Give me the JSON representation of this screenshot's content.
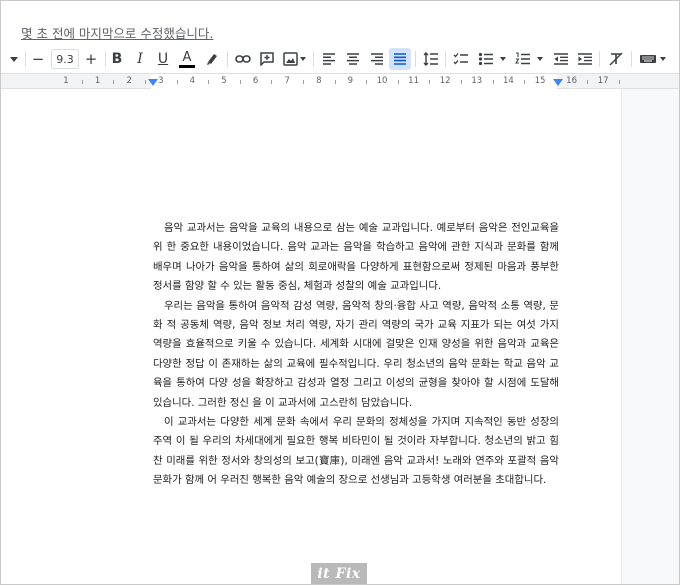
{
  "header": {
    "last_edit": "몇 초 전에 마지막으로 수정했습니다."
  },
  "toolbar": {
    "font_size": "9.3",
    "decrease_label": "−",
    "increase_label": "+",
    "bold_label": "B",
    "italic_label": "I",
    "underline_label": "U",
    "text_color_label": "A"
  },
  "ruler": {
    "ticks": [
      "1",
      "1",
      "2",
      "3",
      "4",
      "5",
      "6",
      "7",
      "8",
      "9",
      "10",
      "11",
      "12",
      "13",
      "14",
      "15",
      "16",
      "17"
    ]
  },
  "document": {
    "paragraphs": [
      "음악 교과서는 음악을 교육의 내용으로 삼는 예술 교과입니다. 예로부터 음악은 전인교육을 위 한 중요한 내용이었습니다. 음악 교과는 음악을 학습하고 음악에 관한 지식과 문화를 함께 배우며 나아가 음악을 통하여 삶의 희로애락을 다양하게 표현함으로써 정제된 마음과 풍부한 정서를 함양 할 수 있는 활동 중심, 체험과 성찰의 예술 교과입니다.",
      "우리는 음악을 통하여 음악적 감성 역량, 음악적 창의·융합 사고 역량, 음악적 소통 역량, 문화 적 공동체 역량, 음악 정보 처리 역량, 자기 관리 역량의 국가 교육 지표가 되는 여섯 가지 역량을 효율적으로 키울 수 있습니다. 세계화 시대에 걸맞은 인재 양성을 위한 음악과 교육은 다양한 정답 이 존재하는 삶의 교육에 필수적입니다. 우리 청소년의 음악 문화는 학교 음악 교육을 통하여 다양 성을 확장하고 감성과 열정 그리고 이성의 균형을 찾아야 할 시점에 도달해 있습니다. 그러한 정신 을 이 교과서에 고스란히 담았습니다.",
      "이 교과서는 다양한 세계 문화 속에서 우리 문화의 정체성을 가지며 지속적인 동반 성장의 주역 이 될 우리의 차세대에게 필요한 행복 비타민이 될 것이라 자부합니다. 청소년의 밝고 힘찬 미래를 위한 정서와 창의성의 보고(寶庫), 미래엔 음악 교과서! 노래와 연주와 포괄적 음악 문화가 함께 어 우러진 행복한 음악 예술의 장으로 선생님과 고등학생 여러분을 초대합니다."
    ]
  },
  "watermark": {
    "text": "it Fix"
  },
  "colors": {
    "accent": "#4285f4",
    "active_bg": "#d3e3fd",
    "text": "#222222"
  }
}
